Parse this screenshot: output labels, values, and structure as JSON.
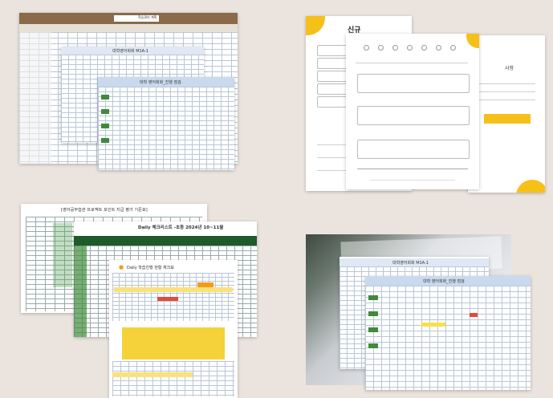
{
  "tl": {
    "sheet_title": "학습관리 계획",
    "inner_title": "대학영어회화 M1A-1",
    "front_title": "대학 영어회화_진행 점검"
  },
  "tr": {
    "form_title": "신규",
    "mid_label": "사항"
  },
  "bl": {
    "rubric_title": "[영어공부습관 프로젝트 포인트 지급 평가 기준표]",
    "checklist_title": "Daily 체크리스트 -초등 2024년 10~11월",
    "todo_title": "Daily 학습진행 현황 체크표"
  },
  "br": {
    "back_title": "대학영어회화 M1A-1",
    "front_title": "대학 영어회화_진행 점검"
  },
  "colors": {
    "background": "#ebe4de",
    "brown_header": "#8a6a4a",
    "blue_header": "#c9d9ee",
    "green_cell": "#3f8a3a",
    "dark_green": "#1f5a2a",
    "yellow": "#f6c01a",
    "orange": "#f39a1a"
  }
}
